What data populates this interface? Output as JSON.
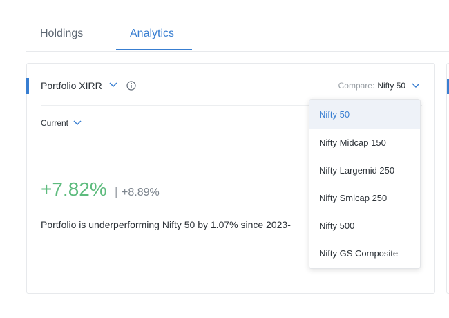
{
  "tabs": {
    "holdings": "Holdings",
    "analytics": "Analytics"
  },
  "card": {
    "title": "Portfolio XIRR",
    "compare_label": "Compare:",
    "compare_value": "Nifty 50",
    "period": "Current",
    "xirr_value": "+7.82%",
    "separator": "|",
    "benchmark_value": "+8.89%",
    "summary": "Portfolio is underperforming Nifty 50 by 1.07% since 2023-"
  },
  "dropdown": {
    "selected_index": 0,
    "options": [
      "Nifty 50",
      "Nifty Midcap 150",
      "Nifty Largemid 250",
      "Nifty Smlcap 250",
      "Nifty 500",
      "Nifty GS Composite"
    ]
  },
  "colors": {
    "accent": "#387ed1",
    "positive": "#5dbb7d"
  }
}
